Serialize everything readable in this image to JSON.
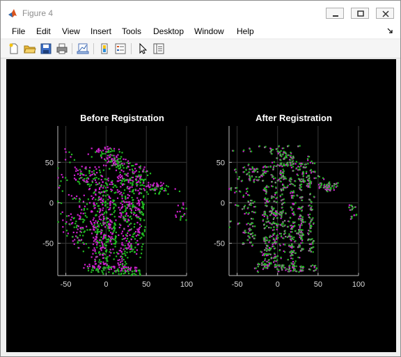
{
  "window": {
    "title": "Figure 4",
    "controls": [
      "minimize",
      "maximize",
      "close"
    ]
  },
  "menubar": {
    "items": [
      "File",
      "Edit",
      "View",
      "Insert",
      "Tools",
      "Desktop",
      "Window",
      "Help"
    ]
  },
  "toolbar": {
    "buttons": [
      {
        "icon": "new-figure-icon"
      },
      {
        "icon": "open-file-icon"
      },
      {
        "icon": "save-icon"
      },
      {
        "icon": "print-icon"
      },
      {
        "icon": "link-plot-icon"
      },
      {
        "icon": "colorbar-icon"
      },
      {
        "icon": "legend-icon"
      },
      {
        "icon": "pointer-icon"
      },
      {
        "icon": "property-inspector-icon"
      }
    ]
  },
  "chart_data": [
    {
      "type": "scatter",
      "title": "Before Registration",
      "xlabel": "",
      "ylabel": "",
      "xlim": [
        -60,
        100
      ],
      "ylim": [
        -90,
        95
      ],
      "xticks": [
        "-50",
        "0",
        "50",
        "100"
      ],
      "yticks": [
        "-50",
        "0",
        "50"
      ],
      "grid": true,
      "series": [
        {
          "color": "#cc22cc",
          "values": "dense point cloud, vertical structures around x=-15..50"
        },
        {
          "color": "#22bb22",
          "values": "dense point cloud, offset from magenta (misaligned)"
        }
      ]
    },
    {
      "type": "scatter",
      "title": "After Registration",
      "xlabel": "",
      "ylabel": "",
      "xlim": [
        -60,
        100
      ],
      "ylim": [
        -90,
        95
      ],
      "xticks": [
        "-50",
        "0",
        "50",
        "100"
      ],
      "yticks": [
        "-50",
        "0",
        "50"
      ],
      "grid": true,
      "series": [
        {
          "color": "#cc22cc",
          "values": "dense point cloud, vertical structures around x=-15..50"
        },
        {
          "color": "#22bb22",
          "values": "dense point cloud, aligned with magenta"
        }
      ]
    }
  ],
  "colors": {
    "figure_background": "#000000",
    "magenta_points": "#cc22cc",
    "green_points": "#22bb22",
    "overlap_points": "#888888"
  }
}
